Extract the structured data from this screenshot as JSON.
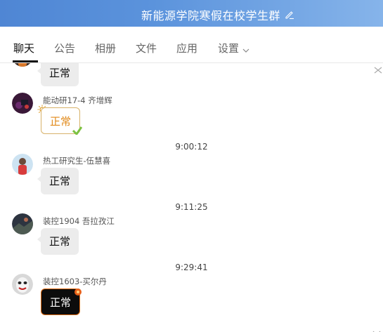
{
  "window": {
    "title": "新能源学院寒假在校学生群"
  },
  "tabs": [
    {
      "label": "聊天"
    },
    {
      "label": "公告"
    },
    {
      "label": "相册"
    },
    {
      "label": "文件"
    },
    {
      "label": "应用"
    },
    {
      "label": "设置"
    }
  ],
  "messages": [
    {
      "sender": "",
      "text": "正常",
      "style": "gray"
    },
    {
      "sender": "能动研17-4 齐增辉",
      "text": "正常",
      "style": "gold",
      "avatar_icon": "dark-avatar-icon"
    },
    {
      "time": "9:00:12"
    },
    {
      "sender": "热工研究生-伍慧喜",
      "text": "正常",
      "style": "gray",
      "avatar_icon": "person-avatar-icon"
    },
    {
      "time": "9:11:25"
    },
    {
      "sender": "装控1904  吾拉孜江",
      "text": "正常",
      "style": "gray",
      "avatar_icon": "landscape-avatar-icon"
    },
    {
      "time": "9:29:41"
    },
    {
      "sender": "装控1603-买尔丹",
      "text": "正常",
      "style": "black",
      "avatar_icon": "mask-avatar-icon"
    }
  ],
  "colors": {
    "titlebar": "#5b93dc",
    "bubble_gray": "#ececec",
    "bubble_gold_text": "#e18a1a",
    "bubble_black": "#0c0c0c"
  }
}
